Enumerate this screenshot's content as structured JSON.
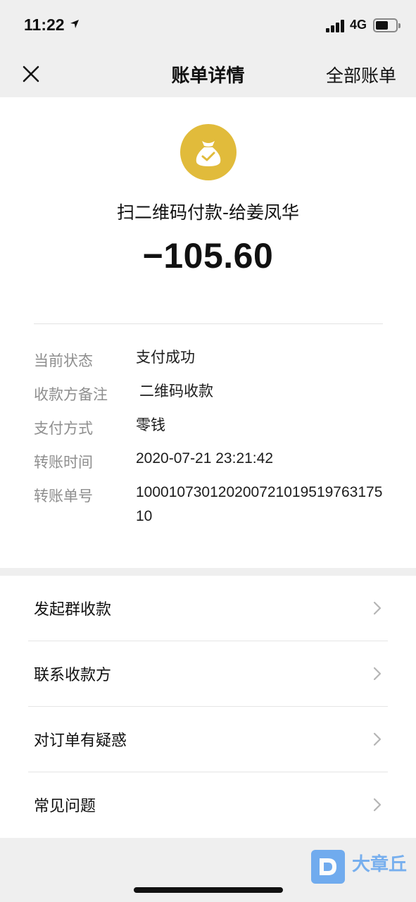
{
  "status_bar": {
    "time": "11:22",
    "network": "4G",
    "icons": [
      "location-arrow-icon",
      "signal-icon",
      "battery-icon"
    ]
  },
  "nav": {
    "title": "账单详情",
    "right_label": "全部账单",
    "close_icon": "close-icon"
  },
  "transaction": {
    "icon": "money-bag-check-icon",
    "icon_color": "#e1bb3b",
    "payee": "扫二维码付款-给姜凤华",
    "amount": "−105.60"
  },
  "details": [
    {
      "label": "当前状态",
      "value": "支付成功"
    },
    {
      "label": "收款方备注",
      "value": "二维码收款"
    },
    {
      "label": "支付方式",
      "value": "零钱"
    },
    {
      "label": "转账时间",
      "value": "2020-07-21 23:21:42"
    },
    {
      "label": "转账单号",
      "value": "10001073012020072101951976317510"
    }
  ],
  "menu": [
    {
      "label": "发起群收款",
      "icon": "chevron-right-icon"
    },
    {
      "label": "联系收款方",
      "icon": "chevron-right-icon"
    },
    {
      "label": "对订单有疑惑",
      "icon": "chevron-right-icon"
    },
    {
      "label": "常见问题",
      "icon": "chevron-right-icon"
    }
  ],
  "watermark": {
    "text": "大章丘",
    "accent": "#5aa0ee"
  }
}
